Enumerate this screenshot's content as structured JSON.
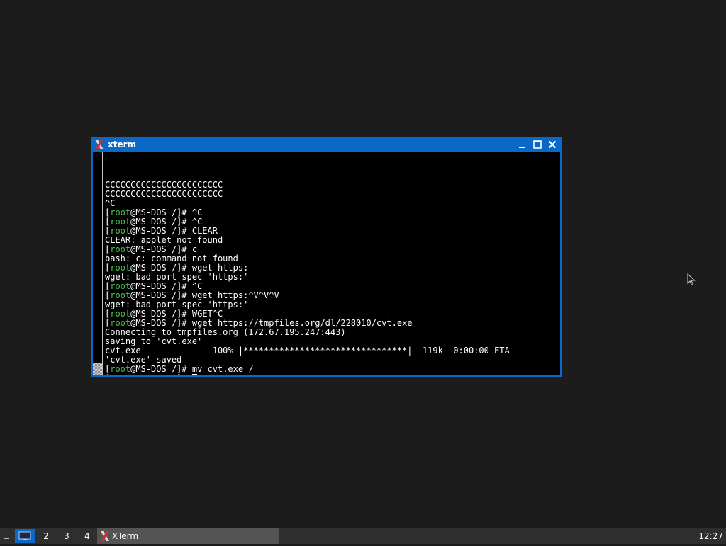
{
  "window": {
    "title": "xterm",
    "icon": "x-logo-icon",
    "controls": [
      "minimize-icon",
      "maximize-icon",
      "close-icon"
    ]
  },
  "terminal": {
    "prompt_user": "root",
    "prompt_host": "@MS-DOS /]# ",
    "lines": [
      {
        "type": "text",
        "text": ""
      },
      {
        "type": "text",
        "text": "CCCCCCCCCCCCCCCCCCCCCCC"
      },
      {
        "type": "text",
        "text": "CCCCCCCCCCCCCCCCCCCCCCC"
      },
      {
        "type": "text",
        "text": "^C"
      },
      {
        "type": "prompt",
        "cmd": "^C"
      },
      {
        "type": "prompt",
        "cmd": "^C"
      },
      {
        "type": "prompt",
        "cmd": "CLEAR"
      },
      {
        "type": "text",
        "text": "CLEAR: applet not found"
      },
      {
        "type": "prompt",
        "cmd": "c"
      },
      {
        "type": "text",
        "text": "bash: c: command not found"
      },
      {
        "type": "prompt",
        "cmd": "wget https:"
      },
      {
        "type": "text",
        "text": "wget: bad port spec 'https:'"
      },
      {
        "type": "prompt",
        "cmd": "^C"
      },
      {
        "type": "prompt",
        "cmd": "wget https:^V^V^V"
      },
      {
        "type": "text",
        "text": "wget: bad port spec 'https:'"
      },
      {
        "type": "prompt",
        "cmd": "WGET^C"
      },
      {
        "type": "prompt",
        "cmd": "wget https://tmpfiles.org/dl/228010/cvt.exe"
      },
      {
        "type": "text",
        "text": "Connecting to tmpfiles.org (172.67.195.247:443)"
      },
      {
        "type": "text",
        "text": "saving to 'cvt.exe'"
      },
      {
        "type": "text",
        "text": "cvt.exe              100% |********************************|  119k  0:00:00 ETA"
      },
      {
        "type": "text",
        "text": "'cvt.exe' saved"
      },
      {
        "type": "prompt",
        "cmd": "mv cvt.exe /"
      },
      {
        "type": "prompt",
        "cmd": "",
        "cursor": true
      }
    ]
  },
  "taskbar": {
    "dash": "_",
    "desktops": [
      "2",
      "3",
      "4"
    ],
    "active_desktop_icon": "monitor-icon",
    "task_label": "XTerm",
    "task_icon": "x-logo-icon",
    "clock": "12:27"
  },
  "colors": {
    "titlebar": "#0a68c8",
    "prompt_user": "#4ec24e",
    "terminal_bg": "#000000",
    "desktop_bg": "#1c1c1c"
  }
}
